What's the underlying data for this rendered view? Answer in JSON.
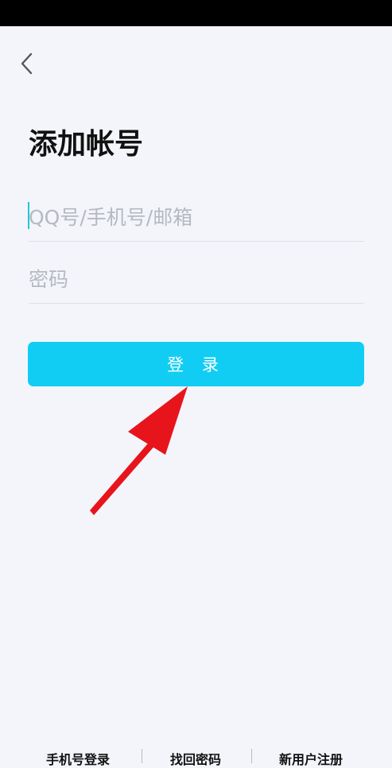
{
  "status_bar": {},
  "nav": {
    "back_icon": "chevron-left-icon"
  },
  "page": {
    "title": "添加帐号"
  },
  "form": {
    "account": {
      "value": "",
      "placeholder": "QQ号/手机号/邮箱"
    },
    "password": {
      "value": "",
      "placeholder": "密码"
    },
    "login_label": "登 录"
  },
  "annotation": {
    "arrow_color": "#e8141c"
  },
  "footer": {
    "links": [
      "手机号登录",
      "找回密码",
      "新用户注册"
    ]
  },
  "colors": {
    "background": "#f3f5fa",
    "accent": "#12cdf3",
    "caret": "#1ec8d8",
    "title": "#111111",
    "placeholder": "#b6b9c0"
  }
}
